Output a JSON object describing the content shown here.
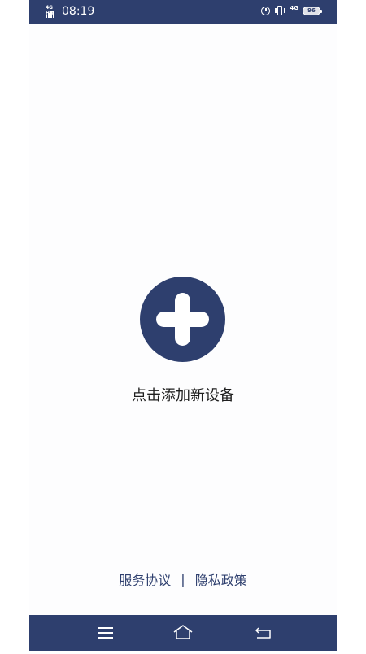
{
  "status_bar": {
    "network_label": "4G HD",
    "time": "08:19",
    "network_right": "4G",
    "battery": "96",
    "icons": [
      "signal-icon",
      "alarm-icon",
      "vibrate-icon",
      "battery-icon"
    ]
  },
  "main": {
    "add_icon": "plus-icon",
    "add_label": "点击添加新设备"
  },
  "footer": {
    "service_agreement": "服务协议",
    "separator": "|",
    "privacy_policy": "隐私政策"
  },
  "nav_bar": {
    "icons": [
      "menu-icon",
      "home-icon",
      "back-icon"
    ]
  },
  "colors": {
    "accent": "#2e3f6e",
    "background": "#fdfdfe",
    "text": "#1f1f1f"
  }
}
